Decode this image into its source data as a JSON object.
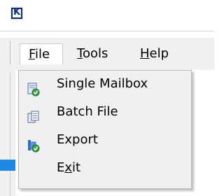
{
  "menubar": {
    "items": [
      {
        "label": "File",
        "mnemonic": "F",
        "rest": "ile"
      },
      {
        "label": "Tools",
        "mnemonic": "T",
        "rest": "ools"
      },
      {
        "label": "Help",
        "mnemonic": "H",
        "rest": "elp"
      }
    ]
  },
  "file_menu": {
    "items": [
      {
        "label": "Single Mailbox",
        "icon": "mailbox-document-check-icon"
      },
      {
        "label": "Batch File",
        "icon": "batch-file-icon"
      },
      {
        "label": "Export",
        "icon": "export-check-icon"
      },
      {
        "label": "Exit",
        "mnemonic": "x",
        "pre": "E",
        "post": "it"
      }
    ]
  },
  "colors": {
    "menubar_bg": "#f0f0f0",
    "dropdown_bg": "#f0f0f0",
    "accent_blue": "#1e88e5",
    "check_green": "#3aa34a"
  }
}
